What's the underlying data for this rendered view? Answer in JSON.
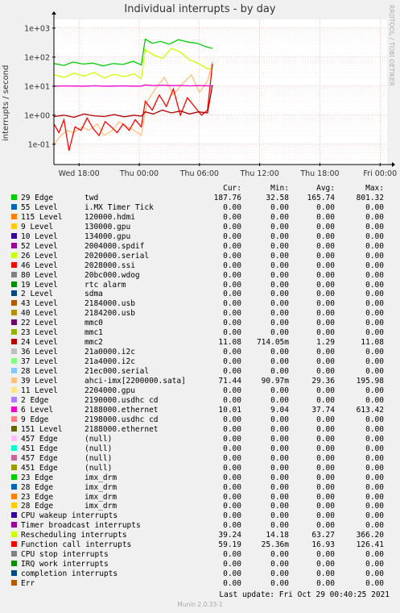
{
  "title": "Individual interrupts - by day",
  "side_credit": "RRDTOOL / TOBI OETIKER",
  "ylabel": "interrupts / second",
  "footer": {
    "last_update": "Last update:  Fri Oct 29 00:40:25 2021",
    "version": "Munin 2.0.33-1"
  },
  "legend_header": {
    "cur": "Cur:",
    "min": "Min:",
    "avg": "Avg:",
    "max": "Max:"
  },
  "legend": [
    {
      "irq": "29 Edge",
      "name": "twd",
      "color": "#00cc00",
      "cur": "187.76",
      "min": "32.58",
      "avg": "165.74",
      "max": "801.32"
    },
    {
      "irq": "55 Level",
      "name": "i.MX Timer Tick",
      "color": "#0066b3",
      "cur": "0.00",
      "min": "0.00",
      "avg": "0.00",
      "max": "0.00"
    },
    {
      "irq": "115 Level",
      "name": "120000.hdmi",
      "color": "#ff8000",
      "cur": "0.00",
      "min": "0.00",
      "avg": "0.00",
      "max": "0.00"
    },
    {
      "irq": "9 Level",
      "name": "130000.gpu",
      "color": "#ffcc00",
      "cur": "0.00",
      "min": "0.00",
      "avg": "0.00",
      "max": "0.00"
    },
    {
      "irq": "10 Level",
      "name": "134000.gpu",
      "color": "#330099",
      "cur": "0.00",
      "min": "0.00",
      "avg": "0.00",
      "max": "0.00"
    },
    {
      "irq": "52 Level",
      "name": "2004000.spdif",
      "color": "#990099",
      "cur": "0.00",
      "min": "0.00",
      "avg": "0.00",
      "max": "0.00"
    },
    {
      "irq": "26 Level",
      "name": "2020000.serial",
      "color": "#ccff00",
      "cur": "0.00",
      "min": "0.00",
      "avg": "0.00",
      "max": "0.00"
    },
    {
      "irq": "46 Level",
      "name": "2028000.ssi",
      "color": "#ff0000",
      "cur": "0.00",
      "min": "0.00",
      "avg": "0.00",
      "max": "0.00"
    },
    {
      "irq": "80 Level",
      "name": "20bc000.wdog",
      "color": "#808080",
      "cur": "0.00",
      "min": "0.00",
      "avg": "0.00",
      "max": "0.00"
    },
    {
      "irq": "19 Level",
      "name": "rtc alarm",
      "color": "#008f00",
      "cur": "0.00",
      "min": "0.00",
      "avg": "0.00",
      "max": "0.00"
    },
    {
      "irq": "2 Level",
      "name": "sdma",
      "color": "#00487d",
      "cur": "0.00",
      "min": "0.00",
      "avg": "0.00",
      "max": "0.00"
    },
    {
      "irq": "43 Level",
      "name": "2184000.usb",
      "color": "#b35a00",
      "cur": "0.00",
      "min": "0.00",
      "avg": "0.00",
      "max": "0.00"
    },
    {
      "irq": "40 Level",
      "name": "2184200.usb",
      "color": "#b38f00",
      "cur": "0.00",
      "min": "0.00",
      "avg": "0.00",
      "max": "0.00"
    },
    {
      "irq": "22 Level",
      "name": "mmc0",
      "color": "#6b006b",
      "cur": "0.00",
      "min": "0.00",
      "avg": "0.00",
      "max": "0.00"
    },
    {
      "irq": "23 Level",
      "name": "mmc1",
      "color": "#8fb300",
      "cur": "0.00",
      "min": "0.00",
      "avg": "0.00",
      "max": "0.00"
    },
    {
      "irq": "24 Level",
      "name": "mmc2",
      "color": "#b30000",
      "cur": "11.08",
      "min": "714.05m",
      "avg": "1.29",
      "max": "11.08"
    },
    {
      "irq": "36 Level",
      "name": "21a0000.i2c",
      "color": "#bebebe",
      "cur": "0.00",
      "min": "0.00",
      "avg": "0.00",
      "max": "0.00"
    },
    {
      "irq": "37 Level",
      "name": "21a4000.i2c",
      "color": "#80ff80",
      "cur": "0.00",
      "min": "0.00",
      "avg": "0.00",
      "max": "0.00"
    },
    {
      "irq": "28 Level",
      "name": "21ec000.serial",
      "color": "#80c9ff",
      "cur": "0.00",
      "min": "0.00",
      "avg": "0.00",
      "max": "0.00"
    },
    {
      "irq": "39 Level",
      "name": "ahci-imx[2200000.sata]",
      "color": "#ffc080",
      "cur": "71.44",
      "min": "90.97m",
      "avg": "29.36",
      "max": "195.98"
    },
    {
      "irq": "11 Level",
      "name": "2204000.gpu",
      "color": "#ffe680",
      "cur": "0.00",
      "min": "0.00",
      "avg": "0.00",
      "max": "0.00"
    },
    {
      "irq": "2 Edge",
      "name": "2190000.usdhc cd",
      "color": "#aa80ff",
      "cur": "0.00",
      "min": "0.00",
      "avg": "0.00",
      "max": "0.00"
    },
    {
      "irq": "6 Level",
      "name": "2188000.ethernet",
      "color": "#ee00cc",
      "cur": "10.01",
      "min": "9.04",
      "avg": "37.74",
      "max": "613.42"
    },
    {
      "irq": "9 Edge",
      "name": "2198000.usdhc cd",
      "color": "#ff8080",
      "cur": "0.00",
      "min": "0.00",
      "avg": "0.00",
      "max": "0.00"
    },
    {
      "irq": "151 Level",
      "name": "2188000.ethernet",
      "color": "#666600",
      "cur": "0.00",
      "min": "0.00",
      "avg": "0.00",
      "max": "0.00"
    },
    {
      "irq": "457 Edge",
      "name": "(null)",
      "color": "#ffbfff",
      "cur": "0.00",
      "min": "0.00",
      "avg": "0.00",
      "max": "0.00"
    },
    {
      "irq": "451 Edge",
      "name": "(null)",
      "color": "#00ffcc",
      "cur": "0.00",
      "min": "0.00",
      "avg": "0.00",
      "max": "0.00"
    },
    {
      "irq": "457 Edge",
      "name": "(null)",
      "color": "#cc6699",
      "cur": "0.00",
      "min": "0.00",
      "avg": "0.00",
      "max": "0.00"
    },
    {
      "irq": "451 Edge",
      "name": "(null)",
      "color": "#999900",
      "cur": "0.00",
      "min": "0.00",
      "avg": "0.00",
      "max": "0.00"
    },
    {
      "irq": "23 Edge",
      "name": "imx_drm",
      "color": "#00cc00",
      "cur": "0.00",
      "min": "0.00",
      "avg": "0.00",
      "max": "0.00"
    },
    {
      "irq": "28 Edge",
      "name": "imx_drm",
      "color": "#0066b3",
      "cur": "0.00",
      "min": "0.00",
      "avg": "0.00",
      "max": "0.00"
    },
    {
      "irq": "23 Edge",
      "name": "imx_drm",
      "color": "#ff8000",
      "cur": "0.00",
      "min": "0.00",
      "avg": "0.00",
      "max": "0.00"
    },
    {
      "irq": "28 Edge",
      "name": "imx_drm",
      "color": "#ffcc00",
      "cur": "0.00",
      "min": "0.00",
      "avg": "0.00",
      "max": "0.00"
    },
    {
      "irq": "",
      "name": "CPU wakeup interrupts",
      "color": "#330099",
      "cur": "0.00",
      "min": "0.00",
      "avg": "0.00",
      "max": "0.00"
    },
    {
      "irq": "",
      "name": "Timer broadcast interrupts",
      "color": "#990099",
      "cur": "0.00",
      "min": "0.00",
      "avg": "0.00",
      "max": "0.00"
    },
    {
      "irq": "",
      "name": "Rescheduling interrupts",
      "color": "#ccff00",
      "cur": "39.24",
      "min": "14.18",
      "avg": "63.27",
      "max": "366.20"
    },
    {
      "irq": "",
      "name": "Function call interrupts",
      "color": "#ff0000",
      "cur": "59.19",
      "min": "25.36m",
      "avg": "16.93",
      "max": "126.41"
    },
    {
      "irq": "",
      "name": "CPU stop interrupts",
      "color": "#808080",
      "cur": "0.00",
      "min": "0.00",
      "avg": "0.00",
      "max": "0.00"
    },
    {
      "irq": "",
      "name": "IRQ work interrupts",
      "color": "#008f00",
      "cur": "0.00",
      "min": "0.00",
      "avg": "0.00",
      "max": "0.00"
    },
    {
      "irq": "",
      "name": "completion interrupts",
      "color": "#00487d",
      "cur": "0.00",
      "min": "0.00",
      "avg": "0.00",
      "max": "0.00"
    },
    {
      "irq": "",
      "name": "Err",
      "color": "#b35a00",
      "cur": "0.00",
      "min": "0.00",
      "avg": "0.00",
      "max": "0.00"
    }
  ],
  "chart_data": {
    "type": "line",
    "title": "Individual interrupts - by day",
    "xlabel": "",
    "ylabel": "interrupts / second",
    "y_scale": "log",
    "ylim": [
      0.02,
      2000
    ],
    "y_ticks": [
      0.1,
      1,
      10,
      100,
      1000
    ],
    "y_tick_labels": [
      "1e-01",
      "1e+00",
      "1e+01",
      "1e+02",
      "1e+03"
    ],
    "x_ticks": [
      "Wed 18:00",
      "Thu 00:00",
      "Thu 06:00",
      "Thu 12:00",
      "Thu 18:00",
      "Fri 00:00"
    ],
    "x_tick_hours": [
      0,
      6,
      12,
      18,
      24,
      30
    ],
    "xlim_hours": [
      -2.5,
      30.7
    ],
    "grid": true,
    "series": [
      {
        "name": "twd",
        "color": "#00cc00",
        "x": [
          -2.5,
          -1.5,
          -0.6,
          0.4,
          1.4,
          2.4,
          3.4,
          4.4,
          5.4,
          6.2,
          6.6,
          7.3,
          8.1,
          9,
          9.9,
          10.9,
          11.8,
          12.6,
          13.3
        ],
        "values": [
          60,
          52,
          68,
          58,
          62,
          50,
          60,
          56,
          72,
          54,
          420,
          300,
          350,
          280,
          400,
          330,
          300,
          230,
          200
        ]
      },
      {
        "name": "ahci-imx[2200000.sata]",
        "color": "#ffc080",
        "x": [
          -2.5,
          -1.8,
          -1.2,
          -0.5,
          0.3,
          1,
          1.8,
          2.5,
          3.3,
          4,
          4.8,
          5.5,
          6.2,
          6.8,
          7.6,
          8.5,
          9.4,
          10.3,
          11.2,
          12,
          12.8,
          13.3
        ],
        "values": [
          0.1,
          0.2,
          0.3,
          0.25,
          0.4,
          0.3,
          0.5,
          0.2,
          0.3,
          0.6,
          0.4,
          0.3,
          0.2,
          3,
          8,
          20,
          5,
          12,
          25,
          6,
          15,
          71.44
        ]
      },
      {
        "name": "Rescheduling interrupts",
        "color": "#ccff00",
        "x": [
          -2.5,
          -1.5,
          -0.5,
          0.5,
          1.5,
          2.5,
          3.5,
          4.5,
          5.5,
          6.2,
          6.6,
          7.4,
          8.3,
          9.2,
          10.1,
          11,
          11.9,
          12.8,
          13.3
        ],
        "values": [
          25,
          20,
          28,
          22,
          30,
          19,
          26,
          21,
          27,
          18,
          180,
          120,
          90,
          200,
          150,
          80,
          60,
          40,
          39.24
        ]
      },
      {
        "name": "Function call interrupts",
        "color": "#ff0000",
        "x": [
          -2.5,
          -2,
          -1.5,
          -1,
          -0.4,
          0.2,
          0.8,
          1.4,
          2,
          2.6,
          3.2,
          3.8,
          4.4,
          5,
          5.6,
          6.2,
          6.6,
          7.3,
          8,
          8.7,
          9.4,
          10.1,
          10.8,
          11.5,
          12.2,
          12.8,
          13.3
        ],
        "values": [
          0.5,
          0.25,
          0.7,
          0.06,
          0.4,
          0.3,
          0.8,
          0.35,
          0.2,
          0.6,
          0.4,
          0.25,
          0.5,
          0.3,
          0.7,
          0.4,
          3,
          1.5,
          5,
          2,
          8,
          1,
          4,
          2,
          1,
          1.5,
          59.19
        ]
      },
      {
        "name": "mmc2",
        "color": "#b30000",
        "x": [
          -2.5,
          -1.5,
          -0.5,
          0.5,
          1.5,
          2.5,
          3.5,
          4.5,
          5.5,
          6.2,
          6.6,
          7.4,
          8.3,
          9.2,
          10.1,
          11,
          11.9,
          12.8,
          13.3
        ],
        "values": [
          0.9,
          1,
          0.85,
          1.1,
          0.95,
          0.9,
          1.05,
          0.88,
          1,
          0.92,
          1.3,
          1.1,
          1.5,
          1.2,
          1.4,
          1.1,
          1.3,
          1.2,
          11.08
        ]
      },
      {
        "name": "2188000.ethernet",
        "color": "#ee00cc",
        "x": [
          -2.5,
          -1.5,
          -0.5,
          0.5,
          1.5,
          2.5,
          3.5,
          4.5,
          5.5,
          6.2,
          6.6,
          7.4,
          8.3,
          9.2,
          10.1,
          11,
          11.9,
          12.8,
          13.3
        ],
        "values": [
          10,
          10.2,
          10.1,
          10,
          10.3,
          10,
          10.1,
          10.2,
          10,
          10,
          11,
          10.5,
          10.8,
          10.4,
          10.6,
          10.2,
          10.5,
          10.3,
          10.01
        ]
      }
    ]
  }
}
